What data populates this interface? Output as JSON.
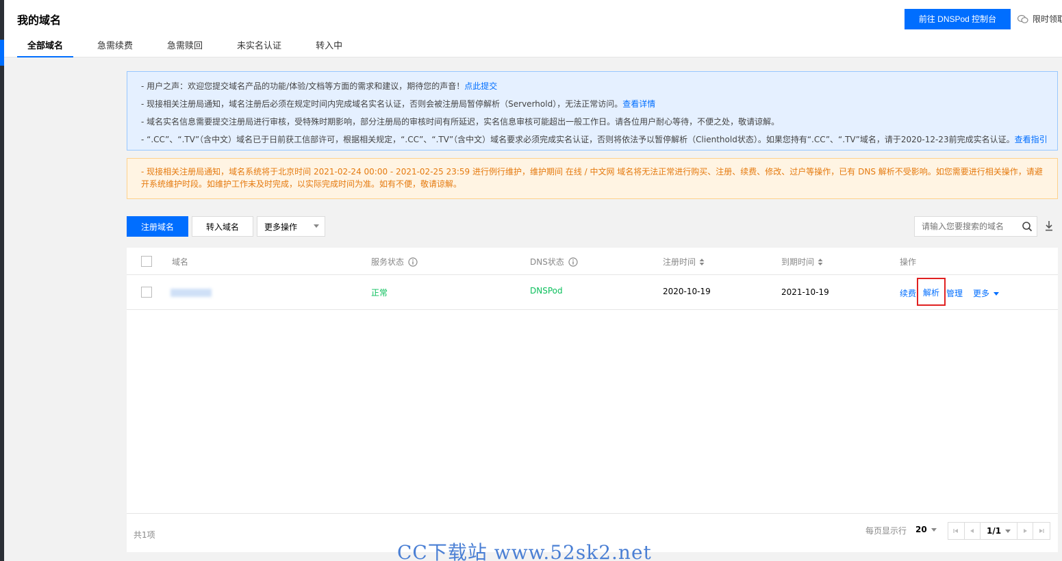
{
  "header": {
    "title": "我的域名",
    "dns_button": "前往 DNSPod 控制台",
    "promo": "限时领取"
  },
  "tabs": [
    {
      "label": "全部域名",
      "active": true
    },
    {
      "label": "急需续费"
    },
    {
      "label": "急需赎回"
    },
    {
      "label": "未实名认证"
    },
    {
      "label": "转入中"
    }
  ],
  "notices": {
    "line1": "- 用户之声：欢迎您提交域名产品的功能/体验/文档等方面的需求和建议，期待您的声音！",
    "line1_link": "点此提交",
    "line2": "- 现接相关注册局通知，域名注册后必须在规定时间内完成域名实名认证，否则会被注册局暂停解析（Serverhold），无法正常访问。",
    "line2_link": "查看详情",
    "line3": "- 域名实名信息需要提交注册局进行审核，受特殊时期影响，部分注册局的审核时间有所延迟，实名信息审核可能超出一般工作日。请各位用户耐心等待，不便之处，敬请谅解。",
    "line4": "- “.CC”、“.TV”（含中文）域名已于日前获工信部许可，根据相关规定，“.CC”、“.TV”（含中文）域名要求必须完成实名认证，否则将依法予以暂停解析（Clienthold状态）。如果您持有“.CC”、“.TV”域名，请于2020-12-23前完成实名认证。",
    "line4_link": "查看指引",
    "warning": "- 现接相关注册局通知，域名系统将于北京时间 2021-02-24 00:00 - 2021-02-25 23:59 进行例行维护，维护期间 在线 / 中文网 域名将无法正常进行购买、注册、续费、修改、过户等操作，已有 DNS 解析不受影响。如您需要进行相关操作，请避开系统维护时段。如维护工作未及时完成，以实际完成时间为准。如有不便，敬请谅解。"
  },
  "toolbar": {
    "register": "注册域名",
    "transfer": "转入域名",
    "more_ops": "更多操作",
    "search_placeholder": "请输入您要搜索的域名"
  },
  "table": {
    "headers": {
      "domain": "域名",
      "service_status": "服务状态",
      "dns_status": "DNS状态",
      "reg_time": "注册时间",
      "expire_time": "到期时间",
      "ops": "操作"
    },
    "rows": [
      {
        "service_status": "正常",
        "dns_status": "DNSPod",
        "reg_time": "2020-10-19",
        "expire_time": "2021-10-19",
        "op_renew": "续费",
        "op_resolve": "解析",
        "op_manage": "管理",
        "op_more": "更多"
      }
    ],
    "footer": {
      "total": "共1项",
      "per_page_label": "每页显示行",
      "per_page": "20",
      "page": "1/1"
    }
  },
  "watermark": "CC下载站 www.52sk2.net"
}
